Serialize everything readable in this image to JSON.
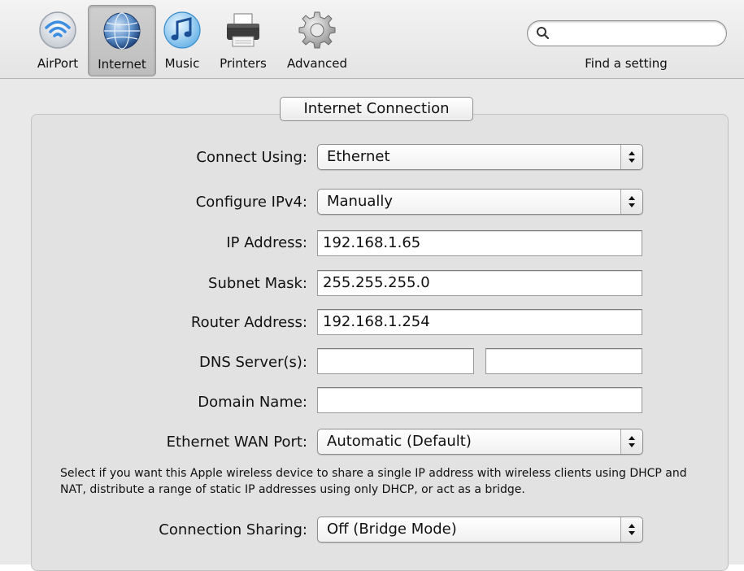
{
  "toolbar": {
    "items": [
      {
        "label": "AirPort",
        "icon": "airport-wifi-icon"
      },
      {
        "label": "Internet",
        "icon": "internet-globe-icon",
        "selected": true
      },
      {
        "label": "Music",
        "icon": "music-note-icon"
      },
      {
        "label": "Printers",
        "icon": "printer-icon"
      },
      {
        "label": "Advanced",
        "icon": "gear-icon"
      }
    ],
    "search": {
      "placeholder": "",
      "value": ""
    },
    "find_label": "Find a setting"
  },
  "section": {
    "title": "Internet Connection"
  },
  "form": {
    "connect_using": {
      "label": "Connect Using:",
      "value": "Ethernet"
    },
    "configure_ipv4": {
      "label": "Configure IPv4:",
      "value": "Manually"
    },
    "ip_address": {
      "label": "IP Address:",
      "value": "192.168.1.65"
    },
    "subnet_mask": {
      "label": "Subnet Mask:",
      "value": "255.255.255.0"
    },
    "router_address": {
      "label": "Router Address:",
      "value": "192.168.1.254"
    },
    "dns_servers": {
      "label": "DNS Server(s):",
      "value1": "",
      "value2": ""
    },
    "domain_name": {
      "label": "Domain Name:",
      "value": ""
    },
    "ethernet_wan_port": {
      "label": "Ethernet WAN Port:",
      "value": "Automatic (Default)"
    },
    "description": "Select if you want this Apple wireless device to share a single IP address with wireless clients using DHCP and NAT, distribute a range of static IP addresses using only DHCP, or act as a bridge.",
    "connection_sharing": {
      "label": "Connection Sharing:",
      "value": "Off (Bridge Mode)"
    }
  },
  "colors": {
    "accent": "#3a6fc4",
    "toolbar_bg": "#e4e4e4",
    "panel_bg": "#e9e9e9"
  }
}
